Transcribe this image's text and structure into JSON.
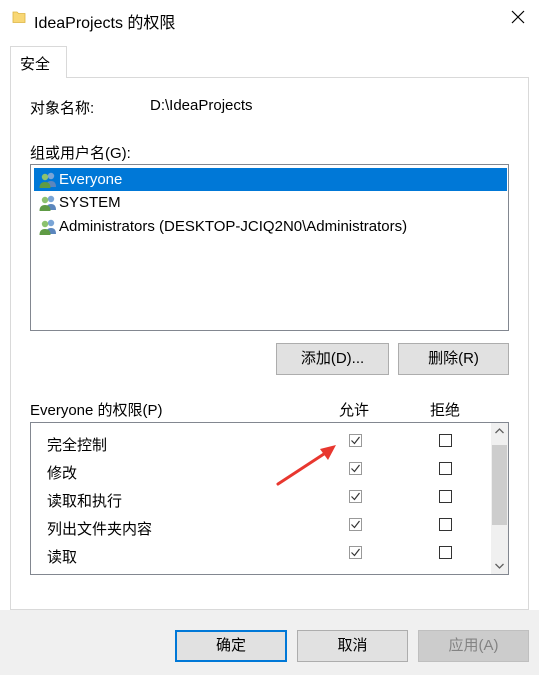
{
  "window": {
    "title": "IdeaProjects 的权限",
    "icon": "folder-icon",
    "close_icon": "close-icon"
  },
  "tabs": [
    {
      "label": "安全",
      "selected": true
    }
  ],
  "object": {
    "label": "对象名称:",
    "value": "D:\\IdeaProjects"
  },
  "groups": {
    "label": "组或用户名(G):",
    "items": [
      {
        "name": "Everyone",
        "icon": "users-icon",
        "selected": true
      },
      {
        "name": "SYSTEM",
        "icon": "users-icon",
        "selected": false
      },
      {
        "name": "Administrators (DESKTOP-JCIQ2N0\\Administrators)",
        "icon": "users-icon",
        "selected": false
      }
    ],
    "add_button": "添加(D)...",
    "remove_button": "删除(R)"
  },
  "permissions": {
    "label": "Everyone 的权限(P)",
    "allow_header": "允许",
    "deny_header": "拒绝",
    "rows": [
      {
        "name": "完全控制",
        "allow": true,
        "deny": false
      },
      {
        "name": "修改",
        "allow": true,
        "deny": false
      },
      {
        "name": "读取和执行",
        "allow": true,
        "deny": false
      },
      {
        "name": "列出文件夹内容",
        "allow": true,
        "deny": false
      },
      {
        "name": "读取",
        "allow": true,
        "deny": false
      }
    ]
  },
  "footer": {
    "ok": "确定",
    "cancel": "取消",
    "apply": "应用(A)",
    "apply_enabled": false
  },
  "colors": {
    "selection": "#0078d7",
    "annotation_arrow": "#e8372f"
  }
}
